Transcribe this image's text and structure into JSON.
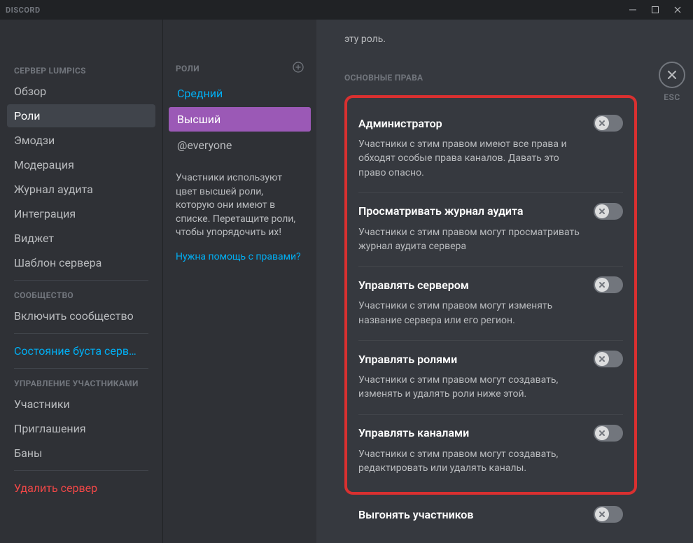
{
  "titlebar": {
    "app_name": "DISCORD"
  },
  "sidebar": {
    "server_header": "СЕРВЕР LUMPICS",
    "items_server": [
      {
        "label": "Обзор"
      },
      {
        "label": "Роли"
      },
      {
        "label": "Эмодзи"
      },
      {
        "label": "Модерация"
      },
      {
        "label": "Журнал аудита"
      },
      {
        "label": "Интеграция"
      },
      {
        "label": "Виджет"
      },
      {
        "label": "Шаблон сервера"
      }
    ],
    "community_header": "СООБЩЕСТВО",
    "community_item": "Включить сообщество",
    "boost_item": "Состояние буста серв…",
    "members_header": "УПРАВЛЕНИЕ УЧАСТНИКАМИ",
    "items_members": [
      {
        "label": "Участники"
      },
      {
        "label": "Приглашения"
      },
      {
        "label": "Баны"
      }
    ],
    "delete_server": "Удалить сервер"
  },
  "roles": {
    "header": "РОЛИ",
    "list": [
      {
        "label": "Средний"
      },
      {
        "label": "Высший"
      },
      {
        "label": "@everyone"
      }
    ],
    "hint": "Участники используют цвет высшей роли, которую они имеют в списке. Перетащите роли, чтобы упорядочить их!",
    "help": "Нужна помощь с правами?"
  },
  "main": {
    "top_text": "эту роль.",
    "section_header": "ОСНОВНЫЕ ПРАВА",
    "permissions": [
      {
        "title": "Администратор",
        "desc": "Участники с этим правом имеют все права и обходят особые права каналов. Давать это право опасно."
      },
      {
        "title": "Просматривать журнал аудита",
        "desc": "Участники с этим правом могут просматривать журнал аудита сервера"
      },
      {
        "title": "Управлять сервером",
        "desc": "Участники с этим правом могут изменять название сервера или его регион."
      },
      {
        "title": "Управлять ролями",
        "desc": "Участники с этим правом могут создавать, изменять и удалять роли ниже этой."
      },
      {
        "title": "Управлять каналами",
        "desc": "Участники с этим правом могут создавать, редактировать или удалять каналы."
      }
    ],
    "outside_perm": {
      "title": "Выгонять участников"
    }
  },
  "close": {
    "label": "ESC"
  }
}
